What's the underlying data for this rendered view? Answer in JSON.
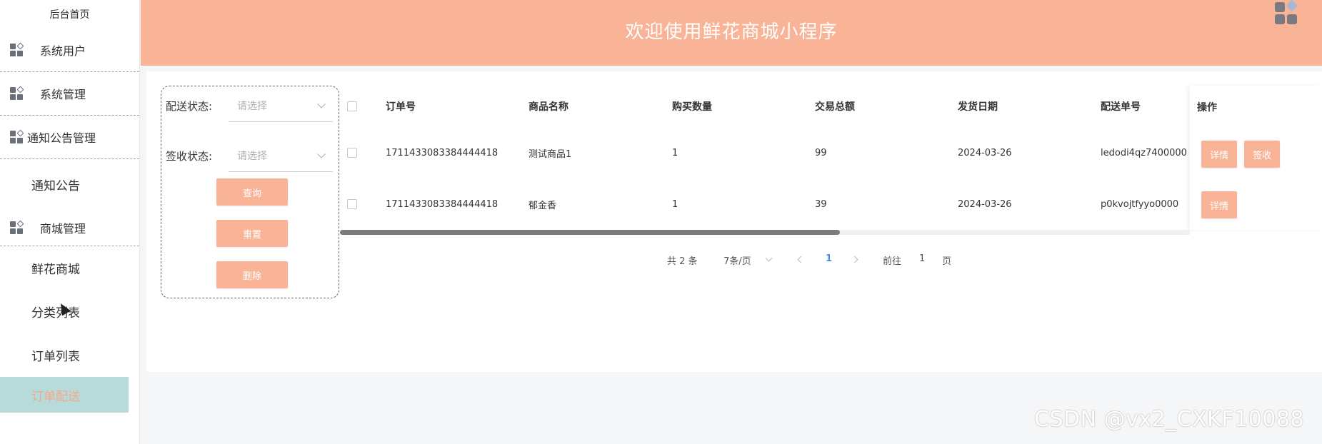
{
  "sidebar": {
    "home": "后台首页",
    "groups": [
      {
        "label": "系统用户",
        "icon": "grid-apps-icon"
      },
      {
        "label": "系统管理",
        "icon": "grid-apps-icon"
      },
      {
        "label": "通知公告管理",
        "icon": "grid-apps-icon"
      }
    ],
    "notice_item": "通知公告",
    "mall_group": {
      "label": "商城管理",
      "icon": "grid-apps-icon"
    },
    "mall_items": [
      "鲜花商城",
      "分类列表",
      "订单列表",
      "订单配送"
    ],
    "active_item": "订单配送"
  },
  "header": {
    "title": "欢迎使用鲜花商城小程序",
    "icon": "grid-apps-icon"
  },
  "filter": {
    "delivery_status_label": "配送状态:",
    "delivery_status_placeholder": "请选择",
    "receipt_status_label": "签收状态:",
    "receipt_status_placeholder": "请选择",
    "query_button": "查询",
    "reset_button": "重置",
    "delete_button": "删除"
  },
  "table": {
    "columns": [
      "订单号",
      "商品名称",
      "购买数量",
      "交易总额",
      "发货日期",
      "配送单号",
      "操作"
    ],
    "rows": [
      {
        "order_no": "1711433083384444418",
        "product": "测试商品1",
        "qty": "1",
        "total": "99",
        "ship_date": "2024-03-26",
        "delivery_no": "ledodi4qz7400000",
        "actions": [
          "详情",
          "签收"
        ]
      },
      {
        "order_no": "1711433083384444418",
        "product": "郁金香",
        "qty": "1",
        "total": "39",
        "ship_date": "2024-03-26",
        "delivery_no": "p0kvojtfyyo0000",
        "actions": [
          "详情"
        ]
      }
    ]
  },
  "pagination": {
    "total": "共 2 条",
    "page_size": "7条/页",
    "current_page": "1",
    "goto_label": "前往",
    "goto_value": "1",
    "page_suffix": "页"
  },
  "watermark": "CSDN @vx2_CXKF10088",
  "colors": {
    "accent": "#f9b497",
    "active_bg": "#b7dada",
    "page_link": "#4a8de8"
  }
}
